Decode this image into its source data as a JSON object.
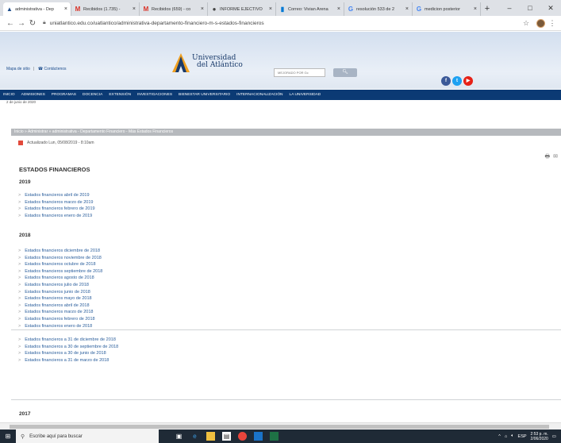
{
  "browser": {
    "tabs": [
      {
        "title": "administrativa - Dep",
        "icon": "ua-logo-icon",
        "color": "#1f4e8c",
        "active": true
      },
      {
        "title": "Recibidos (1.735) -",
        "icon": "gmail-icon",
        "color": "#d93025"
      },
      {
        "title": "Recibidos (659) - co",
        "icon": "gmail-icon",
        "color": "#d93025"
      },
      {
        "title": "INFORME EJECTIVO",
        "icon": "globe-icon",
        "color": "#444444"
      },
      {
        "title": "Correo: Vivian Arena",
        "icon": "outlook-icon",
        "color": "#0078d4"
      },
      {
        "title": "resolución 533 de 2",
        "icon": "google-icon",
        "color": "#4285f4"
      },
      {
        "title": "medicion posterior",
        "icon": "google-icon",
        "color": "#4285f4"
      }
    ],
    "new_tab": "+",
    "window_controls": {
      "minimize": "–",
      "maximize": "□",
      "close": "✕"
    },
    "url": "uniatlantico.edu.co/uatlantico/administrativa-departamento-financiero-m-s-estados-financieros"
  },
  "site": {
    "top_links": [
      "Mapa de sitio",
      "Contáctenos"
    ],
    "logo_line1": "Universidad",
    "logo_line2": "del Atlántico",
    "search_placeholder": "MEJORADO POR Gc",
    "social": [
      {
        "name": "facebook-icon",
        "glyph": "f",
        "color": "#3b5998"
      },
      {
        "name": "twitter-icon",
        "glyph": "t",
        "color": "#1da1f2"
      },
      {
        "name": "youtube-icon",
        "glyph": "▶",
        "color": "#e62117"
      }
    ],
    "menu": [
      "INICIO",
      "ADMISIONES",
      "PROGRAMAS",
      "DOCENCIA",
      "EXTENSIÓN",
      "INVESTIGACIONES",
      "BIENESTAR UNIVERSITARIO",
      "INTERNACIONALIZACIÓN",
      "LA UNIVERSIDAD"
    ],
    "date_strip": "2 de junio de 2020"
  },
  "content": {
    "breadcrumb": "Inicio » Administrar » administrativa - Departamento Financiero - Más Estados Financieros",
    "updated": "Actualizado Lun, 05/08/2019 - 8:10am",
    "title": "ESTADOS FINANCIEROS",
    "year_2019": "2019",
    "items_2019": [
      "Estados financieros abril de 2019",
      "Estados financieros marzo de 2019",
      "Estados financieros febrero de 2019",
      "Estados financieros enero de 2019"
    ],
    "year_2018": "2018",
    "items_2018": [
      "Estados financieros diciembre de 2018",
      "Estados financieros noviembre de 2018",
      "Estados financieros octubre de 2018",
      "Estados financieros septiembre de 2018",
      "Estados financieros agosto de 2018",
      "Estados financieros julio de 2018",
      "Estados financieros junio de 2018",
      "Estados financieros mayo de 2018",
      "Estados financieros abril de 2018",
      "Estados financieros marzo de 2018",
      "Estados financieros febrero de 2018",
      "Estados financieros enero de 2018"
    ],
    "items_2018_quarterly": [
      "Estados financieros a 31 de diciembre de 2018",
      "Estados financieros a 30 de septiembre de 2018",
      "Estados financieros a 30 de junio de 2018",
      "Estados financieros a 31 de marzo de 2018"
    ],
    "year_2017": "2017"
  },
  "taskbar": {
    "search_placeholder": "Escribe aquí para buscar",
    "lang": "ESP",
    "time": "2:53 p. m.",
    "date": "2/06/2020"
  }
}
